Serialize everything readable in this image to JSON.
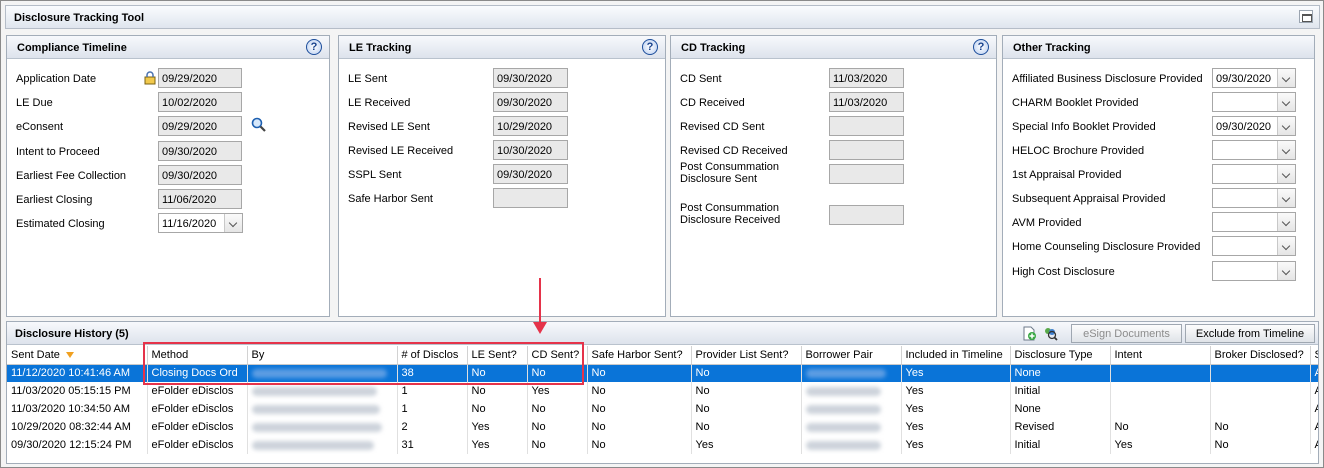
{
  "window": {
    "title": "Disclosure Tracking Tool"
  },
  "compliance": {
    "title": "Compliance Timeline",
    "rows": [
      {
        "label": "Application Date",
        "value": "09/29/2020"
      },
      {
        "label": "LE Due",
        "value": "10/02/2020"
      },
      {
        "label": "eConsent",
        "value": "09/29/2020"
      },
      {
        "label": "Intent to Proceed",
        "value": "09/30/2020"
      },
      {
        "label": "Earliest Fee Collection",
        "value": "09/30/2020"
      },
      {
        "label": "Earliest Closing",
        "value": "11/06/2020"
      },
      {
        "label": "Estimated Closing",
        "value": "11/16/2020"
      }
    ]
  },
  "le": {
    "title": "LE Tracking",
    "rows": [
      {
        "label": "LE Sent",
        "value": "09/30/2020"
      },
      {
        "label": "LE Received",
        "value": "09/30/2020"
      },
      {
        "label": "Revised LE Sent",
        "value": "10/29/2020"
      },
      {
        "label": "Revised LE Received",
        "value": "10/30/2020"
      },
      {
        "label": "SSPL Sent",
        "value": "09/30/2020"
      },
      {
        "label": "Safe Harbor Sent",
        "value": ""
      }
    ]
  },
  "cd": {
    "title": "CD Tracking",
    "rows": [
      {
        "label": "CD Sent",
        "value": "11/03/2020"
      },
      {
        "label": "CD Received",
        "value": "11/03/2020"
      },
      {
        "label": "Revised CD Sent",
        "value": ""
      },
      {
        "label": "Revised CD Received",
        "value": ""
      },
      {
        "label1": "Post Consummation",
        "label2": "Disclosure Sent",
        "value": ""
      },
      {
        "label1": "Post Consummation",
        "label2": "Disclosure Received",
        "value": ""
      }
    ]
  },
  "other": {
    "title": "Other Tracking",
    "rows": [
      {
        "label": "Affiliated Business Disclosure Provided",
        "value": "09/30/2020"
      },
      {
        "label": "CHARM Booklet Provided",
        "value": ""
      },
      {
        "label": "Special Info Booklet Provided",
        "value": "09/30/2020"
      },
      {
        "label": "HELOC Brochure Provided",
        "value": ""
      },
      {
        "label": "1st Appraisal Provided",
        "value": ""
      },
      {
        "label": "Subsequent Appraisal Provided",
        "value": ""
      },
      {
        "label": "AVM Provided",
        "value": ""
      },
      {
        "label": "Home Counseling Disclosure Provided",
        "value": ""
      },
      {
        "label": "High Cost Disclosure",
        "value": ""
      }
    ]
  },
  "history": {
    "title": "Disclosure History (5)",
    "esign_label": "eSign Documents",
    "exclude_label": "Exclude from Timeline",
    "columns": [
      "Sent Date",
      "Method",
      "By",
      "# of Disclos",
      "LE Sent?",
      "CD Sent?",
      "Safe Harbor Sent?",
      "Provider List Sent?",
      "Borrower Pair",
      "Included in Timeline",
      "Disclosure Type",
      "Intent",
      "Broker Disclosed?",
      "S"
    ],
    "rows": [
      {
        "sent": "11/12/2020 10:41:46 AM",
        "method": "Closing Docs Ord",
        "num": "38",
        "le": "No",
        "cd": "No",
        "sh": "No",
        "pl": "No",
        "incl": "Yes",
        "type": "None",
        "intent": "",
        "broker": "",
        "s": "A"
      },
      {
        "sent": "11/03/2020 05:15:15 PM",
        "method": "eFolder eDisclos",
        "num": "1",
        "le": "No",
        "cd": "Yes",
        "sh": "No",
        "pl": "No",
        "incl": "Yes",
        "type": "Initial",
        "intent": "",
        "broker": "",
        "s": "A"
      },
      {
        "sent": "11/03/2020 10:34:50 AM",
        "method": "eFolder eDisclos",
        "num": "1",
        "le": "No",
        "cd": "No",
        "sh": "No",
        "pl": "No",
        "incl": "Yes",
        "type": "None",
        "intent": "",
        "broker": "",
        "s": "A"
      },
      {
        "sent": "10/29/2020 08:32:44 AM",
        "method": "eFolder eDisclos",
        "num": "2",
        "le": "Yes",
        "cd": "No",
        "sh": "No",
        "pl": "No",
        "incl": "Yes",
        "type": "Revised",
        "intent": "No",
        "broker": "No",
        "s": "A"
      },
      {
        "sent": "09/30/2020 12:15:24 PM",
        "method": "eFolder eDisclos",
        "num": "31",
        "le": "Yes",
        "cd": "No",
        "sh": "No",
        "pl": "Yes",
        "incl": "Yes",
        "type": "Initial",
        "intent": "Yes",
        "broker": "No",
        "s": "A"
      }
    ]
  },
  "colors": {
    "accent": "#0a74d8",
    "highlight": "#e5334a"
  }
}
